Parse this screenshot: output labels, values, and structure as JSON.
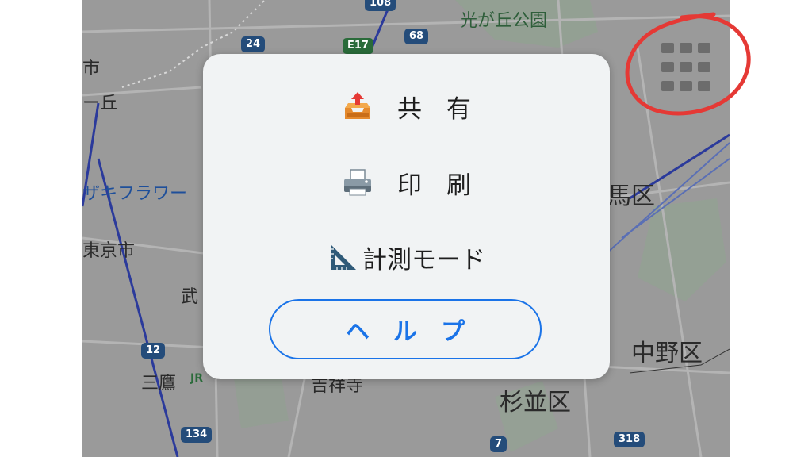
{
  "map": {
    "labels": {
      "park": "光が丘公園",
      "shi": "市",
      "oka": "ー丘",
      "flower": "ザキフラワー",
      "higashikurume": "東京市",
      "musashi": "武",
      "mitaka": "三鷹",
      "jr": "JR",
      "nerima": "馬区",
      "nakano": "中野区",
      "suginami": "杉並区",
      "station": "吉祥寺"
    },
    "shields": {
      "r108": "108",
      "r24": "24",
      "e17": "E17",
      "r68": "68",
      "r12": "12",
      "r134": "134",
      "r7": "7",
      "r318": "318"
    },
    "grid_button_label": "apps-grid"
  },
  "menu": {
    "share_label": "共　有",
    "share_icon": "outbox-tray-icon",
    "print_label": "印　刷",
    "print_icon": "printer-icon",
    "measure_label": "計測モード",
    "measure_icon": "triangular-ruler-icon",
    "help_label": "ヘ　ル　プ"
  },
  "colors": {
    "accent": "#1a73e8",
    "annotation": "#e53935",
    "menu_bg": "#f1f3f4"
  }
}
